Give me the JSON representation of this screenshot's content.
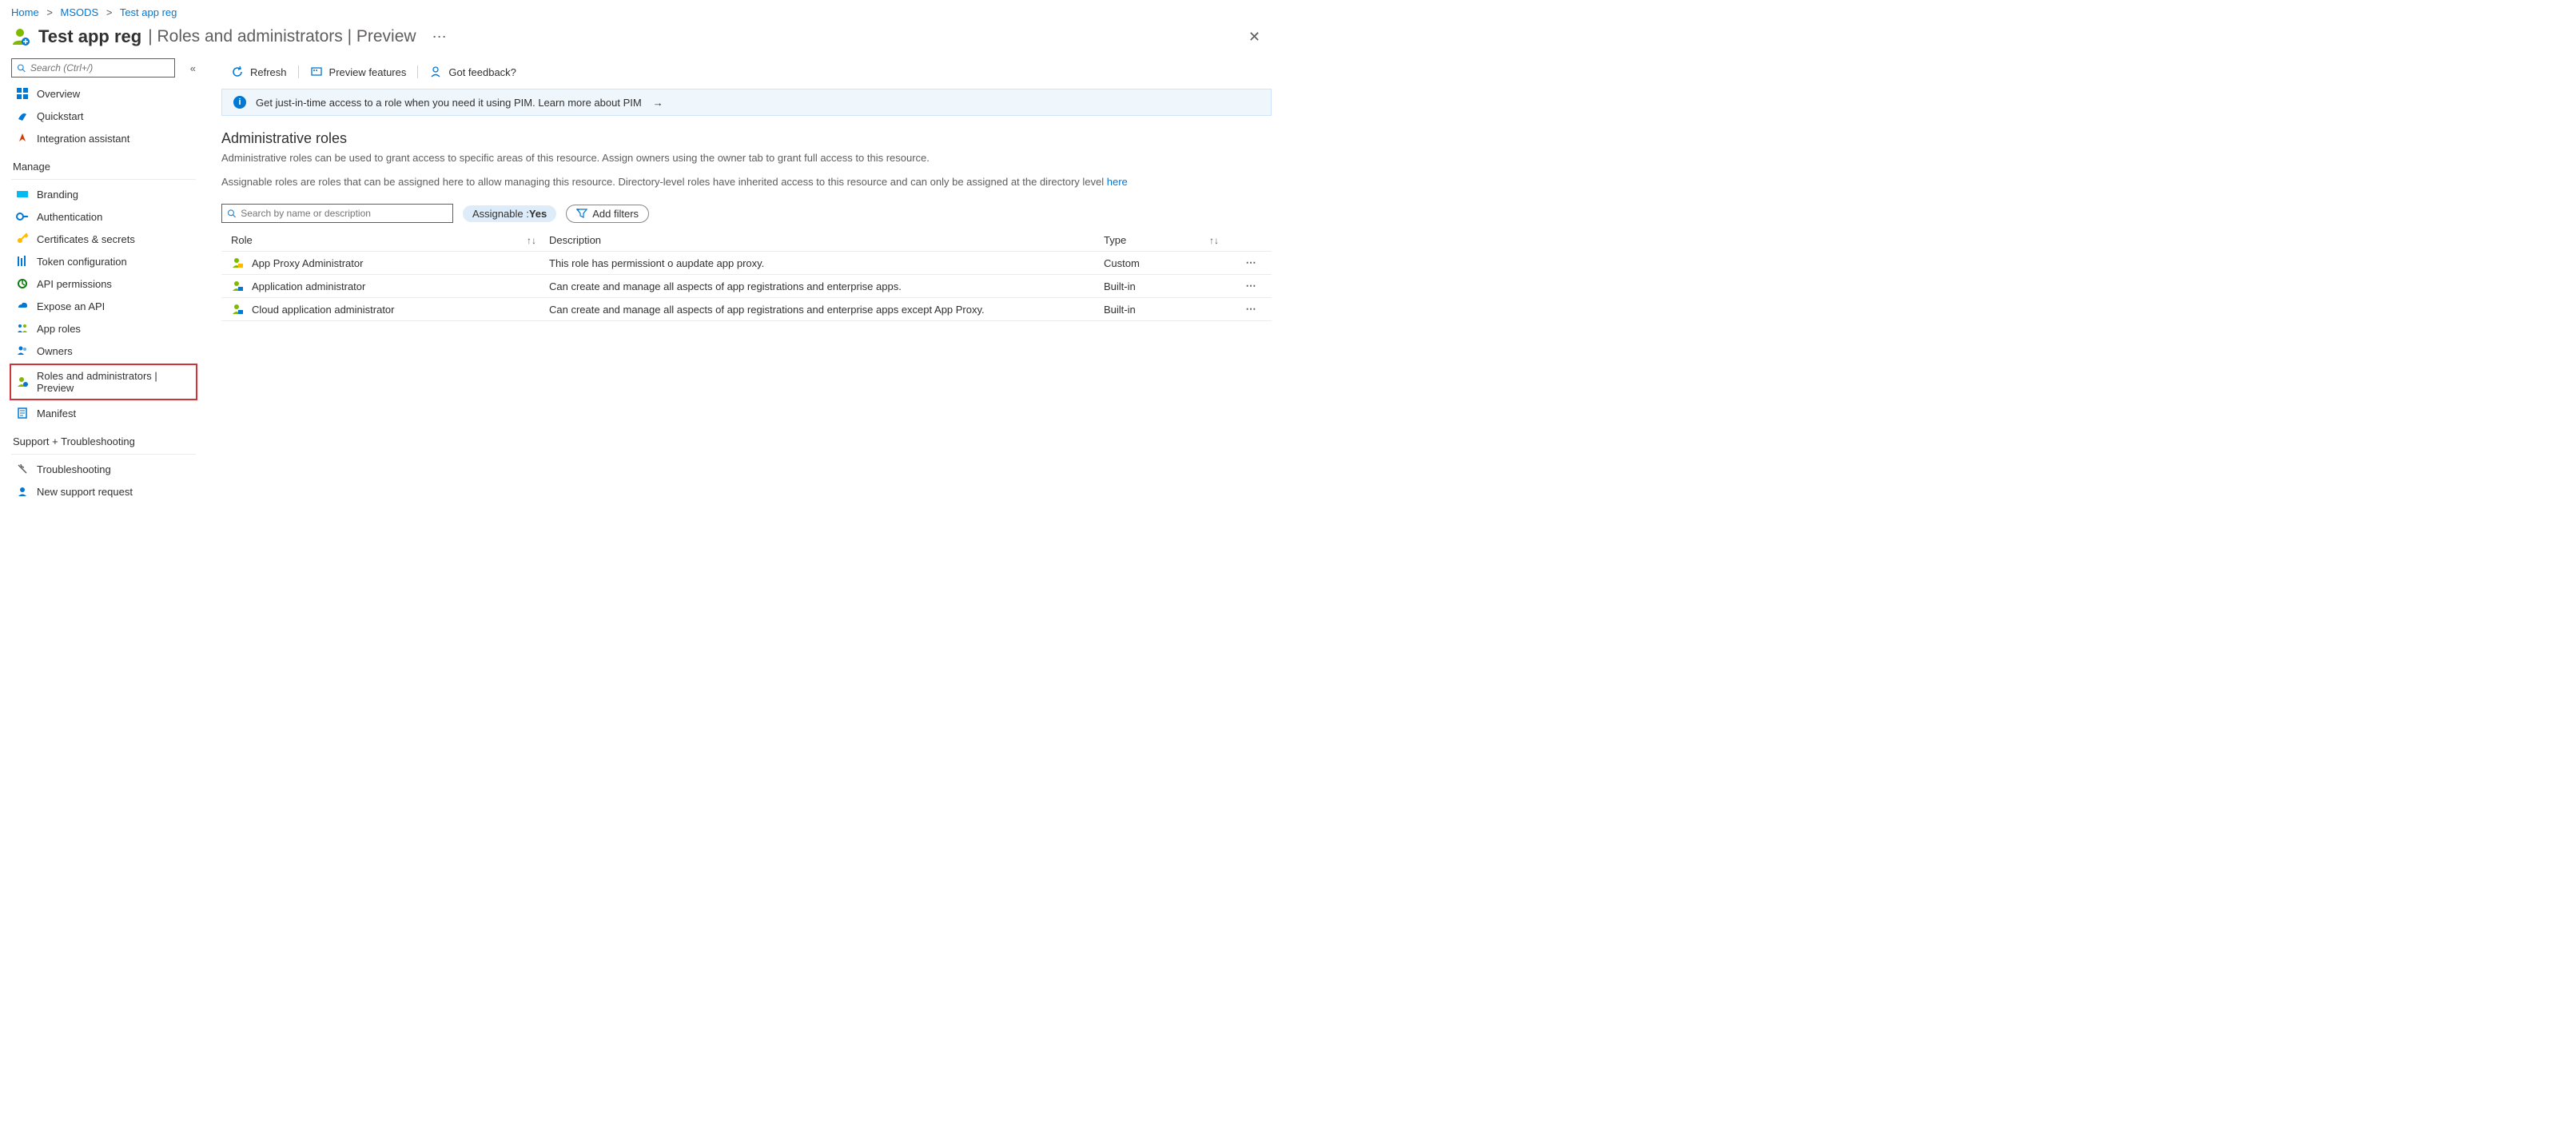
{
  "breadcrumb": {
    "home": "Home",
    "org": "MSODS",
    "app": "Test app reg"
  },
  "header": {
    "title": "Test app reg",
    "subtitle": "| Roles and administrators | Preview"
  },
  "sidebar": {
    "search_placeholder": "Search (Ctrl+/)",
    "items_top": [
      {
        "label": "Overview"
      },
      {
        "label": "Quickstart"
      },
      {
        "label": "Integration assistant"
      }
    ],
    "group_manage": "Manage",
    "items_manage": [
      {
        "label": "Branding"
      },
      {
        "label": "Authentication"
      },
      {
        "label": "Certificates & secrets"
      },
      {
        "label": "Token configuration"
      },
      {
        "label": "API permissions"
      },
      {
        "label": "Expose an API"
      },
      {
        "label": "App roles"
      },
      {
        "label": "Owners"
      },
      {
        "label": "Roles and administrators | Preview"
      },
      {
        "label": "Manifest"
      }
    ],
    "group_support": "Support + Troubleshooting",
    "items_support": [
      {
        "label": "Troubleshooting"
      },
      {
        "label": "New support request"
      }
    ]
  },
  "toolbar": {
    "refresh": "Refresh",
    "preview": "Preview features",
    "feedback": "Got feedback?"
  },
  "banner": {
    "text": "Get just-in-time access to a role when you need it using PIM. Learn more about PIM"
  },
  "section": {
    "heading": "Administrative roles",
    "desc1": "Administrative roles can be used to grant access to specific areas of this resource. Assign owners using the owner tab to grant full access to this resource.",
    "desc2_pre": "Assignable roles are roles that can be assigned here to allow managing this resource. Directory-level roles have inherited access to this resource and can only be assigned at the directory level ",
    "desc2_link": "here"
  },
  "filters": {
    "search_placeholder": "Search by name or description",
    "assignable_label": "Assignable : ",
    "assignable_value": "Yes",
    "add_filters": "Add filters"
  },
  "table": {
    "headers": {
      "role": "Role",
      "description": "Description",
      "type": "Type"
    },
    "rows": [
      {
        "role": "App Proxy Administrator",
        "desc": "This role has permissiont o aupdate app proxy.",
        "type": "Custom"
      },
      {
        "role": "Application administrator",
        "desc": "Can create and manage all aspects of app registrations and enterprise apps.",
        "type": "Built-in"
      },
      {
        "role": "Cloud application administrator",
        "desc": "Can create and manage all aspects of app registrations and enterprise apps except App Proxy.",
        "type": "Built-in"
      }
    ]
  }
}
